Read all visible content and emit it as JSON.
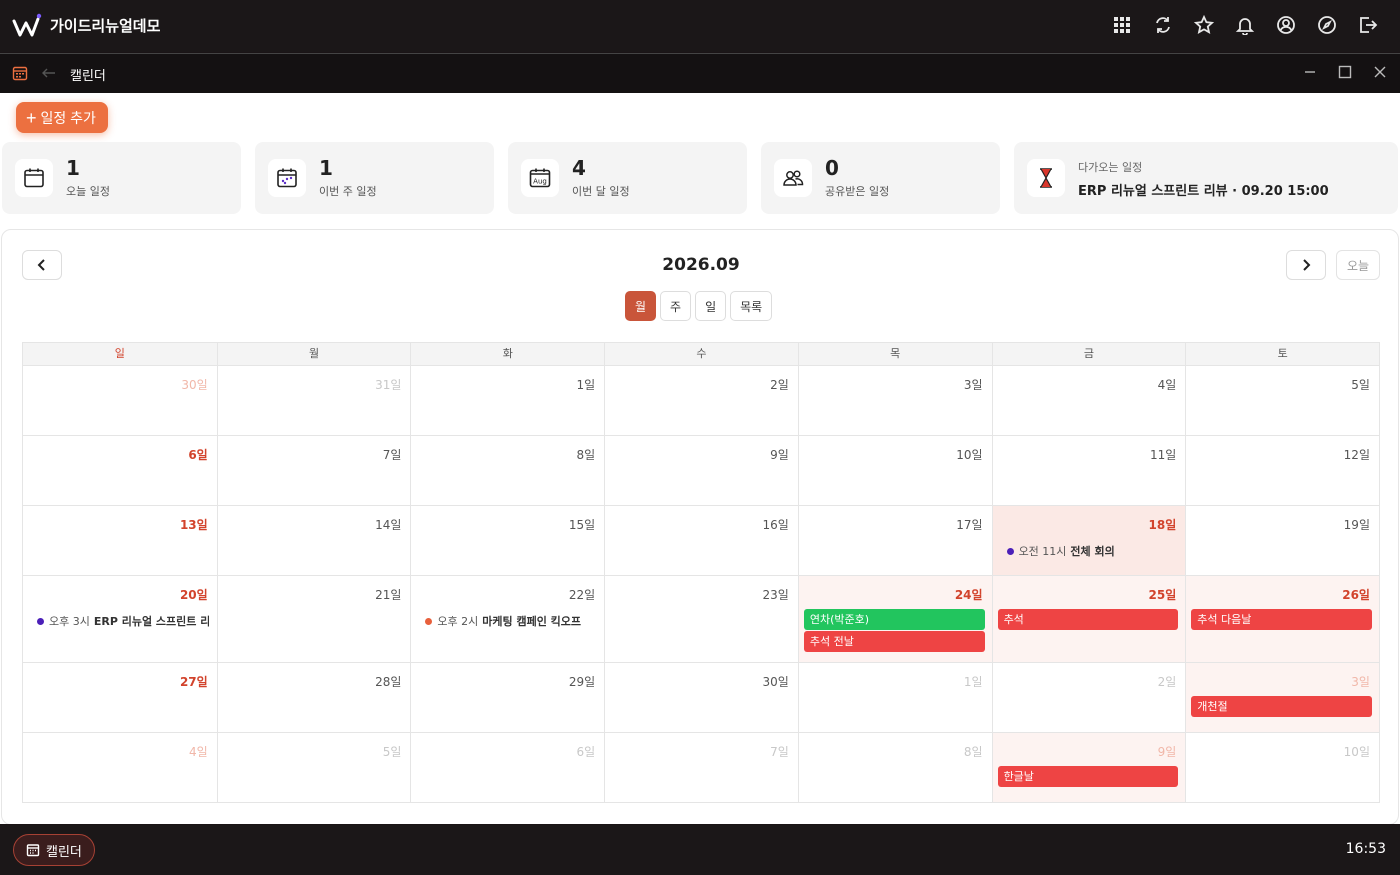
{
  "app": {
    "title": "가이드리뉴얼데모"
  },
  "window": {
    "title": "캘린더"
  },
  "toolbar": {
    "add_label": "일정 추가"
  },
  "stats": [
    {
      "value": "1",
      "label": "오늘 일정",
      "icon": "calendar-icon"
    },
    {
      "value": "1",
      "label": "이번 주 일정",
      "icon": "calendar-week-icon"
    },
    {
      "value": "4",
      "label": "이번 달 일정",
      "icon": "calendar-month-icon",
      "icon_text": "Aug"
    },
    {
      "value": "0",
      "label": "공유받은 일정",
      "icon": "users-icon"
    }
  ],
  "upcoming": {
    "label": "다가오는 일정",
    "text": "ERP 리뉴얼 스프린트 리뷰 · 09.20 15:00",
    "icon": "hourglass-icon"
  },
  "calendar": {
    "title": "2026.09",
    "today_label": "오늘",
    "views": [
      "월",
      "주",
      "일",
      "목록"
    ],
    "active_view": "월",
    "weekdays": [
      "일",
      "월",
      "화",
      "수",
      "목",
      "금",
      "토"
    ],
    "weeks": [
      [
        "30일",
        "31일",
        "1일",
        "2일",
        "3일",
        "4일",
        "5일"
      ],
      [
        "6일",
        "7일",
        "8일",
        "9일",
        "10일",
        "11일",
        "12일"
      ],
      [
        "13일",
        "14일",
        "15일",
        "16일",
        "17일",
        "18일",
        "19일"
      ],
      [
        "20일",
        "21일",
        "22일",
        "23일",
        "24일",
        "25일",
        "26일"
      ],
      [
        "27일",
        "28일",
        "29일",
        "30일",
        "1일",
        "2일",
        "3일"
      ],
      [
        "4일",
        "5일",
        "6일",
        "7일",
        "8일",
        "9일",
        "10일"
      ]
    ],
    "events": {
      "e18": {
        "time": "오전 11시",
        "title": "전체 회의",
        "color": "#4b1fb8"
      },
      "e20": {
        "time": "오후 3시",
        "title": "ERP 리뉴얼 스프린트 리뷰",
        "color": "#4b1fb8"
      },
      "e22": {
        "time": "오후 2시",
        "title": "마케팅 캠페인 킥오프",
        "color": "#e8603c"
      }
    },
    "allday": {
      "d24a": "연차(박준호)",
      "d24b": "추석 전날",
      "d25": "추석",
      "d26": "추석 다음날",
      "d3": "개천절",
      "d9": "한글날"
    }
  },
  "colors": {
    "accent": "#ec7040",
    "holiday": "#ee4444",
    "leave": "#22c55e",
    "sunday": "#d2432c"
  },
  "taskbar": {
    "item_label": "캘린더",
    "clock": "16:53"
  }
}
